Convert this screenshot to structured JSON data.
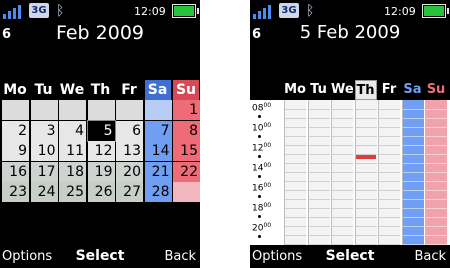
{
  "colors": {
    "weekday_cell": "#e7e7e7",
    "muted_cell": "#c3c8c3",
    "saturday": "#6f9ef3",
    "sunday": "#ef6b78",
    "selected": "#000000",
    "event": "#e23b3b"
  },
  "status": {
    "network": "3G",
    "time": "12:09",
    "signal_icon": "signal-bars-icon",
    "bluetooth_icon": "bluetooth-icon",
    "battery_icon": "battery-icon"
  },
  "month_view": {
    "week_number": "6",
    "title": "Feb 2009",
    "weekdays": [
      "Mo",
      "Tu",
      "We",
      "Th",
      "Fr",
      "Sa",
      "Su"
    ],
    "weeks": [
      [
        "",
        "",
        "",
        "",
        "",
        "",
        "1"
      ],
      [
        "2",
        "3",
        "4",
        "5",
        "6",
        "7",
        "8"
      ],
      [
        "9",
        "10",
        "11",
        "12",
        "13",
        "14",
        "15"
      ],
      [
        "16",
        "17",
        "18",
        "19",
        "20",
        "21",
        "22"
      ],
      [
        "23",
        "24",
        "25",
        "26",
        "27",
        "28",
        ""
      ]
    ],
    "selected_day": "5",
    "softkeys": {
      "left": "Options",
      "center": "Select",
      "right": "Back"
    }
  },
  "week_view": {
    "week_number": "6",
    "title": "5 Feb 2009",
    "weekdays": [
      "Mo",
      "Tu",
      "We",
      "Th",
      "Fr",
      "Sa",
      "Su"
    ],
    "selected_weekday": "Th",
    "time_labels": [
      "08",
      "10",
      "12",
      "14",
      "16",
      "18",
      "20"
    ],
    "minutes_suffix": "00",
    "event": {
      "day": "Th",
      "time": "13:00"
    },
    "softkeys": {
      "left": "Options",
      "center": "Select",
      "right": "Back"
    }
  }
}
